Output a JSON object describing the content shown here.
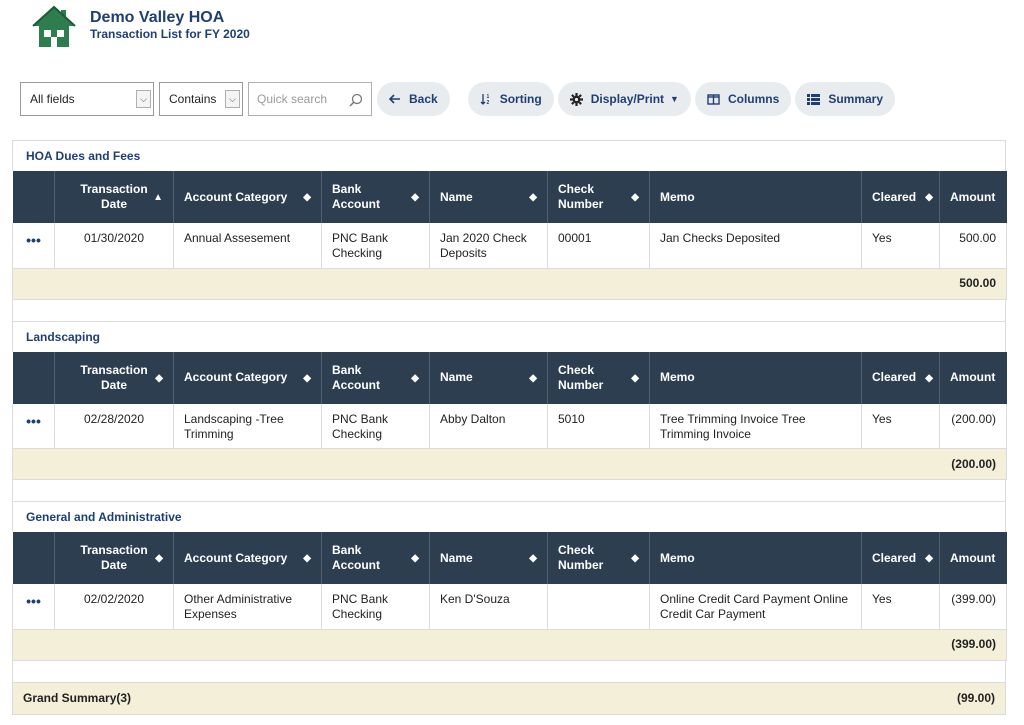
{
  "header": {
    "org_name": "Demo Valley HOA",
    "subtitle": "Transaction List for FY 2020"
  },
  "toolbar": {
    "field_select": "All fields",
    "operator_select": "Contains",
    "search_placeholder": "Quick search",
    "back": "Back",
    "sorting": "Sorting",
    "display_print": "Display/Print",
    "columns": "Columns",
    "summary": "Summary"
  },
  "columns": {
    "transaction_date": "Transaction Date",
    "account_category": "Account Category",
    "bank_account": "Bank Account",
    "name": "Name",
    "check_number": "Check Number",
    "memo": "Memo",
    "cleared": "Cleared",
    "amount": "Amount"
  },
  "groups": [
    {
      "title": "HOA Dues and Fees",
      "rows": [
        {
          "date": "01/30/2020",
          "category": "Annual Assesement",
          "bank": "PNC Bank Checking",
          "name": "Jan 2020 Check Deposits",
          "check": "00001",
          "memo": "Jan Checks Deposited",
          "cleared": "Yes",
          "amount": "500.00"
        }
      ],
      "subtotal": "500.00"
    },
    {
      "title": "Landscaping",
      "rows": [
        {
          "date": "02/28/2020",
          "category": "Landscaping -Tree Trimming",
          "bank": "PNC Bank Checking",
          "name": "Abby Dalton",
          "check": "5010",
          "memo": "Tree Trimming Invoice Tree Trimming Invoice",
          "cleared": "Yes",
          "amount": "(200.00)"
        }
      ],
      "subtotal": "(200.00)"
    },
    {
      "title": "General and Administrative",
      "rows": [
        {
          "date": "02/02/2020",
          "category": "Other Administrative Expenses",
          "bank": "PNC Bank Checking",
          "name": "Ken D'Souza",
          "check": "",
          "memo": "Online Credit Card Payment Online Credit Car Payment",
          "cleared": "Yes",
          "amount": "(399.00)"
        }
      ],
      "subtotal": "(399.00)"
    }
  ],
  "grand_summary": {
    "label": "Grand Summary(3)",
    "amount": "(99.00)"
  },
  "icons": {
    "row_menu": "ellipsis-icon",
    "logo": "house-logo"
  },
  "colors": {
    "header_bg": "#2c3e50",
    "title_color": "#1f3f73",
    "subtotal_bg": "#f3efd8",
    "logo_green": "#2e7d4f"
  }
}
